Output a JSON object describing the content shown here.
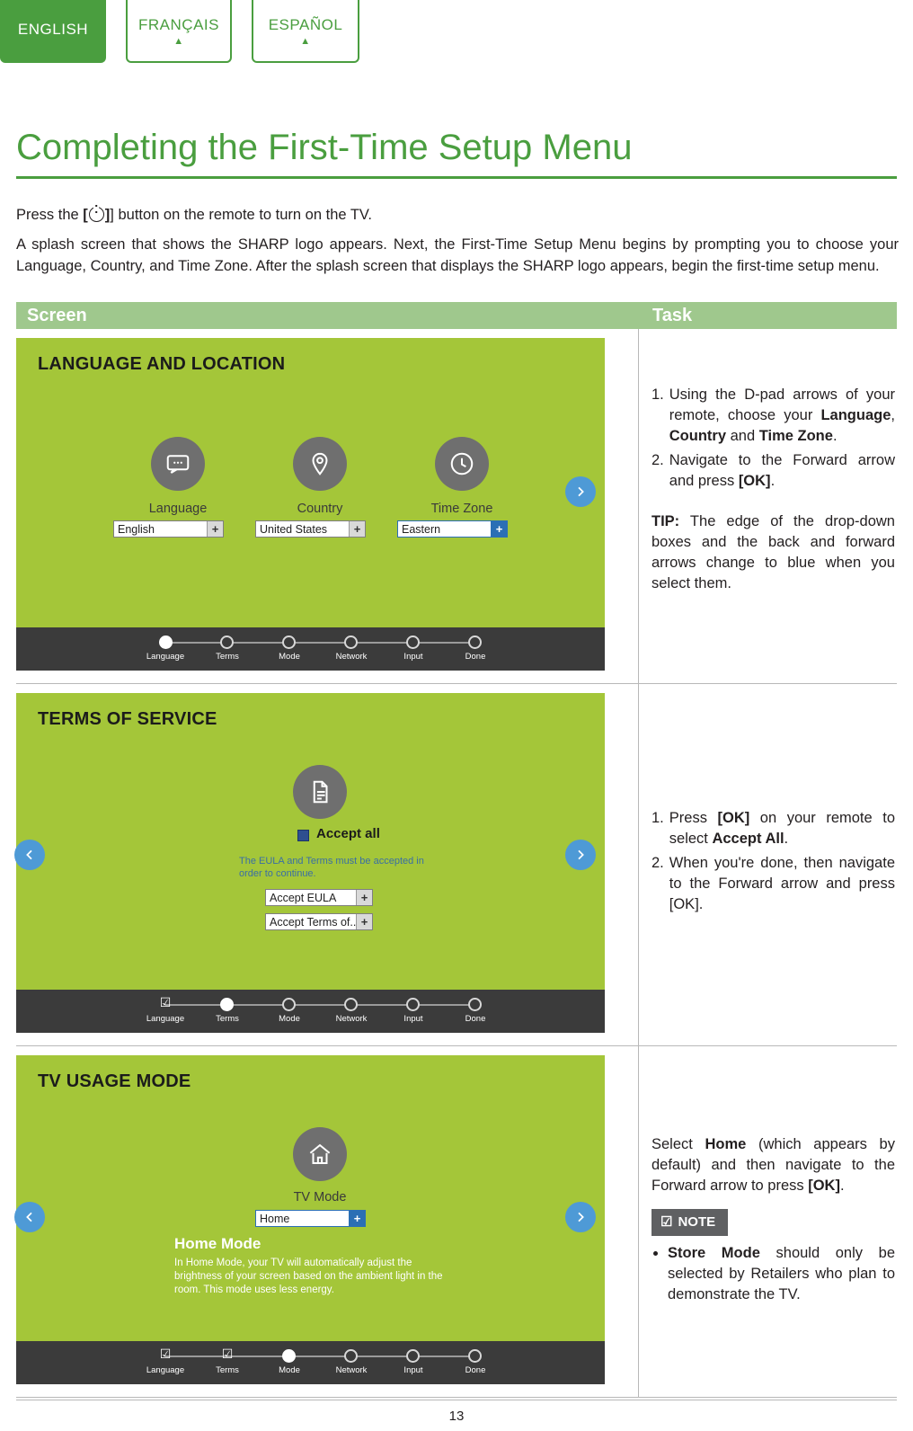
{
  "language_tabs": [
    {
      "label": "ENGLISH",
      "active": true,
      "arrow": ""
    },
    {
      "label": "FRANÇAIS",
      "active": false,
      "arrow": "▲"
    },
    {
      "label": "ESPAÑOL",
      "active": false,
      "arrow": "▲"
    }
  ],
  "page": {
    "title": "Completing the First-Time Setup Menu",
    "number": "13",
    "accent_color": "#4a9e3f"
  },
  "intro": {
    "line1_pre": "Press the ",
    "line1_bracket_open": "[",
    "line1_bracket_close": "]",
    "line1_post": "] button on the remote to turn on the TV.",
    "paragraph": "A splash screen that shows the SHARP logo appears. Next, the First-Time Setup Menu begins by prompting you to choose your Language, Country, and Time Zone. After the splash screen that displays the SHARP logo appears, begin the first-time setup menu."
  },
  "table": {
    "headers": {
      "screen": "Screen",
      "task": "Task"
    },
    "rows": [
      {
        "screen": {
          "title": "LANGUAGE AND LOCATION",
          "fields": [
            {
              "label": "Language",
              "value": "English",
              "icon": "speech-bubble-icon",
              "highlight": false
            },
            {
              "label": "Country",
              "value": "United States",
              "icon": "location-pin-icon",
              "highlight": false
            },
            {
              "label": "Time Zone",
              "value": "Eastern",
              "icon": "clock-icon",
              "highlight": true
            }
          ],
          "forward_arrow": "›",
          "steps": [
            {
              "label": "Language",
              "state": "filled"
            },
            {
              "label": "Terms",
              "state": "empty"
            },
            {
              "label": "Mode",
              "state": "empty"
            },
            {
              "label": "Network",
              "state": "empty"
            },
            {
              "label": "Input",
              "state": "empty"
            },
            {
              "label": "Done",
              "state": "empty"
            }
          ]
        },
        "task": {
          "items": [
            {
              "num": "1.",
              "text_parts": [
                "Using the D-pad arrows of your remote, choose your ",
                "Language",
                ", ",
                "Country",
                " and ",
                "Time Zone",
                "."
              ]
            },
            {
              "num": "2.",
              "text_parts": [
                "Navigate to the Forward arrow and press ",
                "[OK]",
                "."
              ]
            }
          ],
          "tip_label": "TIP:",
          "tip_text": " The edge of the drop-down boxes and the back and forward arrows change to blue when you select them."
        }
      },
      {
        "screen": {
          "title": "TERMS OF SERVICE",
          "icon": "document-icon",
          "accept_all_label": "Accept all",
          "note": "The EULA and Terms must be accepted in order to continue.",
          "dropdowns": [
            {
              "value": "Accept EULA"
            },
            {
              "value": "Accept Terms of..."
            }
          ],
          "back_arrow": "‹",
          "forward_arrow": "›",
          "steps": [
            {
              "label": "Language",
              "state": "check"
            },
            {
              "label": "Terms",
              "state": "filled"
            },
            {
              "label": "Mode",
              "state": "empty"
            },
            {
              "label": "Network",
              "state": "empty"
            },
            {
              "label": "Input",
              "state": "empty"
            },
            {
              "label": "Done",
              "state": "empty"
            }
          ]
        },
        "task": {
          "items": [
            {
              "num": "1.",
              "text_parts": [
                "Press ",
                "[OK]",
                " on your remote to select ",
                "Accept All",
                "."
              ]
            },
            {
              "num": "2.",
              "text_parts": [
                "When you're done, then navigate to the Forward arrow and press [OK]."
              ]
            }
          ]
        }
      },
      {
        "screen": {
          "title": "TV USAGE MODE",
          "icon": "home-icon",
          "field_label": "TV Mode",
          "field_value": "Home",
          "mode_heading": "Home Mode",
          "mode_body": "In Home Mode, your TV will automatically adjust the brightness of your screen based on the ambient light in the room. This mode uses less energy.",
          "back_arrow": "‹",
          "forward_arrow": "›",
          "steps": [
            {
              "label": "Language",
              "state": "check"
            },
            {
              "label": "Terms",
              "state": "check"
            },
            {
              "label": "Mode",
              "state": "filled"
            },
            {
              "label": "Network",
              "state": "empty"
            },
            {
              "label": "Input",
              "state": "empty"
            },
            {
              "label": "Done",
              "state": "empty"
            }
          ]
        },
        "task": {
          "paragraph_parts": [
            "Select ",
            "Home",
            " (which appears by default) and then navigate to the Forward arrow to press ",
            "[OK]",
            "."
          ],
          "note_label": "NOTE",
          "note_icon": "note-pencil-icon",
          "bullets": [
            {
              "bold": "Store Mode",
              "text": " should only be selected by Retailers who plan to demonstrate the TV."
            }
          ]
        }
      }
    ]
  }
}
